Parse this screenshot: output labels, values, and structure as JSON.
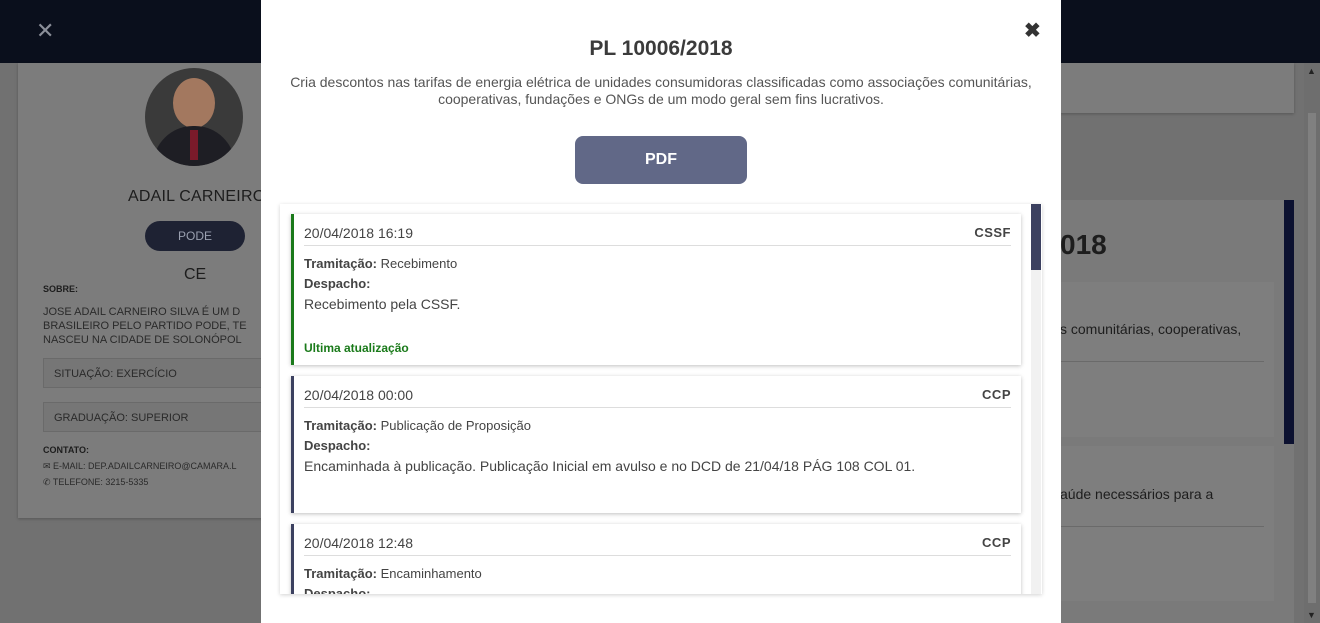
{
  "background": {
    "topbar_close_icon": "close-icon",
    "profile": {
      "name": "ADAIL CARNEIRO",
      "party": "PODE",
      "state": "CE",
      "about_label": "SOBRE:",
      "about_text": "JOSE ADAIL CARNEIRO SILVA É UM D\nBRASILEIRO PELO PARTIDO PODE, TE\nNASCEU NA CIDADE DE SOLONÓPOL",
      "situation": "SITUAÇÃO: EXERCÍCIO",
      "education": "GRADUAÇÃO: SUPERIOR",
      "contact_label": "CONTATO:",
      "email": "✉ E-MAIL: DEP.ADAILCARNEIRO@CAMARA.L",
      "phone": "✆ TELEFONE: 3215-5335"
    },
    "right_panel": {
      "title_fragment": "018",
      "text1": "s comunitárias, cooperativas,",
      "text2": "aúde necessários para a"
    }
  },
  "modal": {
    "close_icon": "close-icon",
    "close_glyph": "✖",
    "title": "PL 10006/2018",
    "description": "Cria descontos nas tarifas de energia elétrica de unidades consumidoras classificadas como associações comunitárias, cooperativas, fundações e ONGs de um modo geral sem fins lucrativos.",
    "pdf_label": "PDF",
    "labels": {
      "tramitacao": "Tramitação:",
      "despacho": "Despacho:",
      "latest": "Ultima atualização"
    },
    "entries": [
      {
        "date": "20/04/2018 16:19",
        "org": "CSSF",
        "tramitacao": "Recebimento",
        "despacho": "Recebimento pela CSSF.",
        "latest": true
      },
      {
        "date": "20/04/2018 00:00",
        "org": "CCP",
        "tramitacao": "Publicação de Proposição",
        "despacho": "Encaminhada à publicação. Publicação Inicial em avulso e no DCD de 21/04/18 PÁG 108 COL 01.",
        "latest": false
      },
      {
        "date": "20/04/2018 12:48",
        "org": "CCP",
        "tramitacao": "Encaminhamento",
        "despacho": "",
        "latest": false
      }
    ]
  },
  "colors": {
    "accent": "#616887",
    "latest_green": "#1a7a1a",
    "entry_border": "#3c4160"
  }
}
